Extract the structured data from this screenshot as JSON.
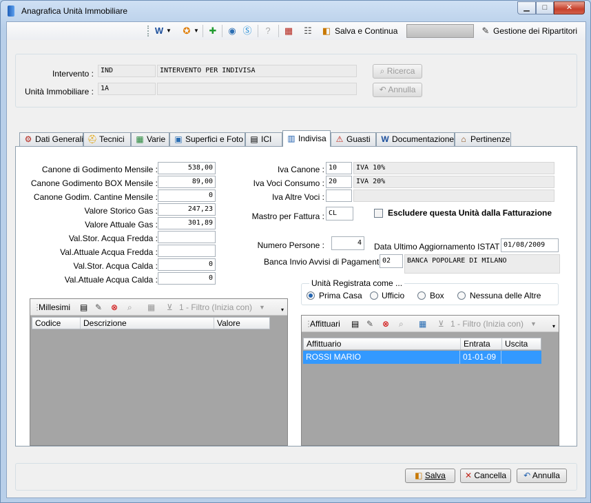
{
  "window": {
    "title": "Anagrafica Unità Immobiliare"
  },
  "toolbar": {
    "save_continue": "Salva e Continua",
    "ripartitori": "Gestione dei Ripartitori"
  },
  "header": {
    "intervento_label": "Intervento :",
    "intervento_code": "IND",
    "intervento_desc": "INTERVENTO PER INDIVISA",
    "unita_label": "Unità Immobiliare :",
    "unita_code": "1A",
    "unita_desc": "",
    "ricerca": "Ricerca",
    "annulla": "Annulla"
  },
  "tabs": [
    {
      "label": "Dati Generali",
      "icon": "⚙"
    },
    {
      "label": "Tecnici",
      "icon": "⛑"
    },
    {
      "label": "Varie",
      "icon": "▦"
    },
    {
      "label": "Superfici e Foto",
      "icon": "▣"
    },
    {
      "label": "ICI",
      "icon": "▤"
    },
    {
      "label": "Indivisa",
      "icon": "▥"
    },
    {
      "label": "Guasti",
      "icon": "⚠"
    },
    {
      "label": "Documentazione",
      "icon": "W"
    },
    {
      "label": "Pertinenze",
      "icon": "⌂"
    }
  ],
  "left_fields": [
    {
      "label": "Canone di Godimento Mensile :",
      "value": "538,00"
    },
    {
      "label": "Canone Godimento BOX Mensile :",
      "value": "89,00"
    },
    {
      "label": "Canone Godim. Cantine Mensile :",
      "value": "0"
    },
    {
      "label": "Valore Storico Gas :",
      "value": "247,23"
    },
    {
      "label": "Valore Attuale Gas :",
      "value": "301,89"
    },
    {
      "label": "Val.Stor. Acqua Fredda :",
      "value": ""
    },
    {
      "label": "Val.Attuale Acqua Fredda :",
      "value": ""
    },
    {
      "label": "Val.Stor. Acqua Calda :",
      "value": "0"
    },
    {
      "label": "Val.Attuale Acqua Calda :",
      "value": "0"
    }
  ],
  "iva": {
    "canone_label": "Iva Canone :",
    "canone_code": "10",
    "canone_desc": "IVA 10%",
    "consumo_label": "Iva Voci Consumo :",
    "consumo_code": "20",
    "consumo_desc": "IVA 20%",
    "altre_label": "Iva Altre Voci :",
    "altre_code": "",
    "altre_desc": ""
  },
  "mastro": {
    "label": "Mastro per Fattura :",
    "value": "CL"
  },
  "escludere_label": "Escludere questa Unità dalla Fatturazione",
  "numero_persone": {
    "label": "Numero Persone :",
    "value": "4"
  },
  "istat": {
    "label": "Data Ultimo Aggiornamento ISTAT :",
    "value": "01/08/2009"
  },
  "banca": {
    "label": "Banca Invio Avvisi di Pagamento :",
    "code": "02",
    "name": "BANCA POPOLARE DI MILANO"
  },
  "unita_registrata": {
    "title": "Unità Registrata come ...",
    "options": [
      "Prima Casa",
      "Ufficio",
      "Box",
      "Nessuna delle Altre"
    ],
    "selected": "Prima Casa"
  },
  "millesimi": {
    "title": "Millesimi",
    "filter": "1 - Filtro (Inizia con)",
    "columns": [
      "Codice",
      "Descrizione",
      "Valore"
    ]
  },
  "affittuari": {
    "title": "Affittuari",
    "filter": "1 - Filtro (Inizia con)",
    "columns": [
      "Affittuario",
      "Entrata",
      "Uscita"
    ],
    "rows": [
      {
        "affittuario": "ROSSI MARIO",
        "entrata": "01-01-09",
        "uscita": ""
      }
    ]
  },
  "footer": {
    "salva": "Salva",
    "cancella": "Cancella",
    "annulla": "Annulla"
  }
}
